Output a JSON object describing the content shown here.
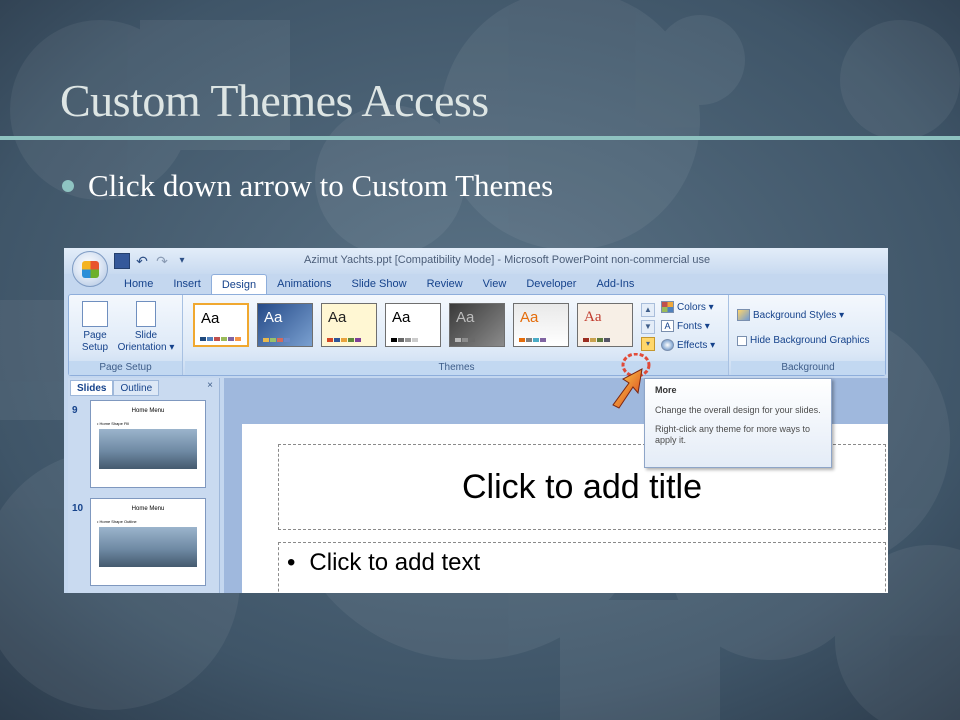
{
  "slide": {
    "title": "Custom Themes Access",
    "bullet": "Click down arrow to Custom Themes"
  },
  "colors": {
    "background": "#3e5468",
    "title_text": "#dde5e4",
    "rule": "#8ec2c0",
    "bullet_dot": "#8fc4c2"
  },
  "screenshot": {
    "window_title": "Azimut Yachts.ppt [Compatibility Mode] - Microsoft PowerPoint non-commercial use",
    "tabs": [
      "Home",
      "Insert",
      "Design",
      "Animations",
      "Slide Show",
      "Review",
      "View",
      "Developer",
      "Add-Ins"
    ],
    "active_tab": "Design",
    "page_setup": {
      "page_setup_line1": "Page",
      "page_setup_line2": "Setup",
      "orientation_line1": "Slide",
      "orientation_line2": "Orientation ▾",
      "group_label": "Page Setup"
    },
    "themes": {
      "group_label": "Themes",
      "thumb_label": "Aa",
      "colors_label": "Colors ▾",
      "fonts_label": "Fonts ▾",
      "effects_label": "Effects ▾"
    },
    "background": {
      "styles_label": "Background Styles ▾",
      "hide_graphics_label": "Hide Background Graphics",
      "group_label": "Background"
    },
    "panel": {
      "tab_slides": "Slides",
      "tab_outline": "Outline",
      "close": "×",
      "thumbnails": [
        {
          "number": "9",
          "title": "Home Menu",
          "bullet": "• Home Shape Fill"
        },
        {
          "number": "10",
          "title": "Home Menu",
          "bullet": "• Home Shape Outline"
        }
      ]
    },
    "slide_canvas": {
      "title_placeholder": "Click to add title",
      "body_bullet": "•",
      "body_placeholder": "Click to add text"
    },
    "tooltip": {
      "heading": "More",
      "line1": "Change the overall design for your slides.",
      "line2": "Right-click any theme for more ways to apply it."
    }
  }
}
